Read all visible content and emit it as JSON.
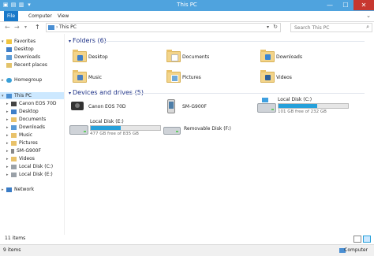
{
  "window": {
    "title": "This PC",
    "minimize": "—",
    "maximize": "☐",
    "close": "✕"
  },
  "ribbon": {
    "tabs": [
      "File",
      "Computer",
      "View"
    ]
  },
  "address": {
    "crumb": "This PC",
    "separator": "›",
    "search_placeholder": "Search This PC"
  },
  "sidebar": {
    "favorites": {
      "label": "Favorites",
      "items": [
        "Desktop",
        "Downloads",
        "Recent places"
      ]
    },
    "homegroup": "Homegroup",
    "thispc": {
      "label": "This PC",
      "items": [
        "Canon EOS 70D",
        "Desktop",
        "Documents",
        "Downloads",
        "Music",
        "Pictures",
        "SM-G900F",
        "Videos",
        "Local Disk (C:)",
        "Local Disk (E:)"
      ]
    },
    "network": "Network"
  },
  "folders": {
    "header": "Folders (6)",
    "items": [
      "Desktop",
      "Documents",
      "Downloads",
      "Music",
      "Pictures",
      "Videos"
    ]
  },
  "devices": {
    "header": "Devices and drives (5)",
    "items": [
      {
        "name": "Canon EOS 70D"
      },
      {
        "name": "SM-G900F"
      },
      {
        "name": "Local Disk (C:)",
        "free": "101 GB free of 232 GB",
        "used_fraction": 0.56
      },
      {
        "name": "Local Disk (E:)",
        "free": "477 GB free of 835 GB",
        "used_fraction": 0.43
      },
      {
        "name": "Removable Disk (F:)"
      }
    ]
  },
  "status": {
    "items": "11 items",
    "bottom_left": "9 items",
    "bottom_right": "Computer"
  },
  "colors": {
    "titlebar": "#4fa3de",
    "file_tab": "#1979ca",
    "section": "#1e3287",
    "bar_fill": "#26a0da",
    "close": "#c7372f"
  }
}
